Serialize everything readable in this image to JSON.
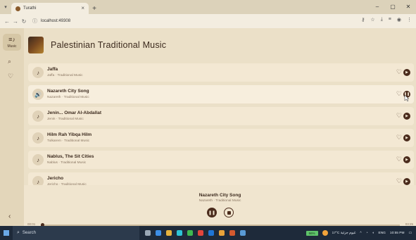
{
  "browser": {
    "tab_title": "Turathi",
    "url": "localhost:49308",
    "new_tab": "+",
    "tab_close": "×",
    "win_min": "–",
    "win_max": "▢",
    "win_close": "✕"
  },
  "sidebar": {
    "music_label": "Music"
  },
  "header": {
    "title": "Palestinian Traditional Music"
  },
  "songs": [
    {
      "title": "Jaffa",
      "subtitle": "Jaffa · Traditional Music",
      "icon": "♪"
    },
    {
      "title": "Nazareth City Song",
      "subtitle": "Nazareth · Traditional Music",
      "icon": "🔊"
    },
    {
      "title": "Jenin... Omar Al-Abdallat",
      "subtitle": "Jenin · Traditional Music",
      "icon": "♪"
    },
    {
      "title": "Hilm Rah Yibqa Hilm",
      "subtitle": "Tulkarem · Traditional Music",
      "icon": "♪"
    },
    {
      "title": "Nablus, The Sit Cities",
      "subtitle": "Nablus · Traditional Music",
      "icon": "♪"
    },
    {
      "title": "Jericho",
      "subtitle": "Jericho · Traditional Music",
      "icon": "♪"
    }
  ],
  "player": {
    "now_playing_title": "Nazareth City Song",
    "now_playing_subtitle": "Nazareth · Traditional Music",
    "current_time": "00:01",
    "total_time": "03:25",
    "progress": 0.005
  },
  "taskbar": {
    "search_placeholder": "Search",
    "battery": "66%",
    "weather": "17°C غيوم جزئية",
    "lang": "ENG",
    "time": "10:55 PM"
  },
  "colors": {
    "accent": "#4a2b1c",
    "background": "#ebe0c8",
    "row": "#f3e8d3"
  }
}
